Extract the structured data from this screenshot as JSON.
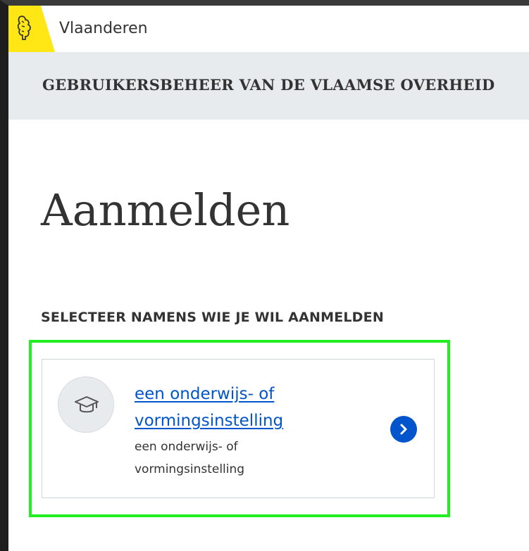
{
  "topbar": {
    "brand": "Vlaanderen",
    "logo_icon": "flemish-lion-icon",
    "logo_color": "#ffe615"
  },
  "header": {
    "title": "GEBRUIKERSBEHEER VAN DE VLAAMSE OVERHEID"
  },
  "main": {
    "title": "Aanmelden",
    "section_label": "SELECTEER NAMENS WIE JE WIL AANMELDEN",
    "options": [
      {
        "title": "een onderwijs- of vormingsinstelling",
        "description": "een onderwijs- of vormingsinstelling",
        "icon": "graduation-cap-icon",
        "action_icon": "chevron-right-icon"
      }
    ]
  },
  "colors": {
    "link": "#0055cc",
    "highlight": "#22ee22",
    "header_band": "#e8ebee"
  }
}
